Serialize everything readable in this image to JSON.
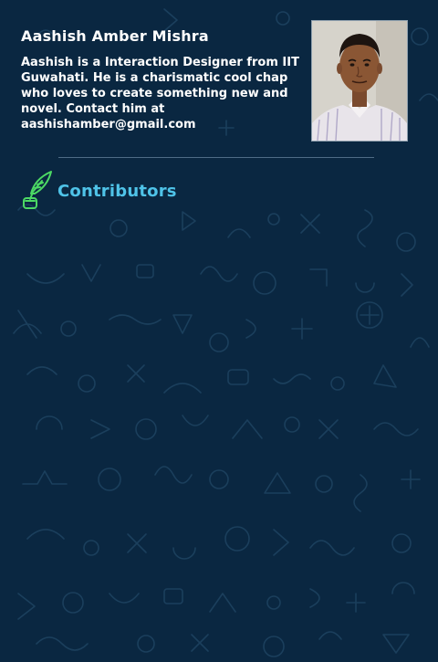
{
  "profile": {
    "name": "Aashish Amber Mishra",
    "bio": "Aashish is a Interaction Designer from IIT Guwahati. He is a charismatic cool chap who loves to create something new and novel. Contact him at aashishamber@gmail.com",
    "photo_icon": "person-photo"
  },
  "contributors": {
    "label": "Contributors",
    "icon": "quill-pen-icon"
  },
  "colors": {
    "background": "#0a2741",
    "text": "#ffffff",
    "accent": "#4fc3e8",
    "icon_green": "#4cd964",
    "divider": "#4f6c86"
  }
}
